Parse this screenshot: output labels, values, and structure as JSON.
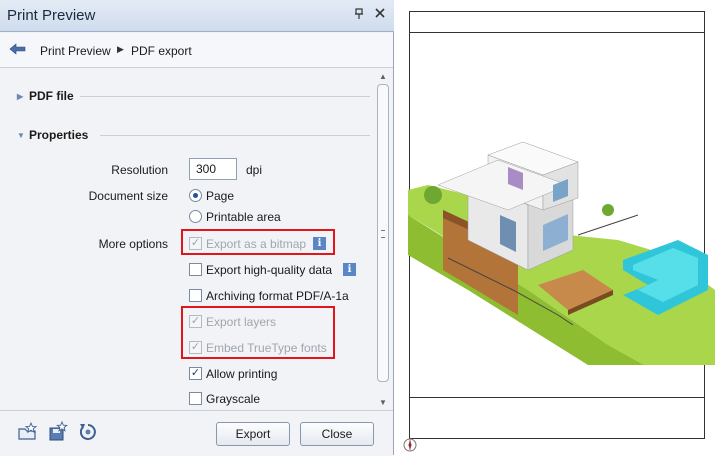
{
  "window": {
    "title": "Print Preview",
    "pin_glyph": "📌",
    "close_glyph": "✕"
  },
  "breadcrumb": {
    "items": [
      "Print Preview",
      "PDF export"
    ],
    "separator": "▶"
  },
  "sections": {
    "pdf_file": {
      "label": "PDF file",
      "expanded": false
    },
    "properties": {
      "label": "Properties",
      "expanded": true
    }
  },
  "resolution": {
    "label": "Resolution",
    "value": "300",
    "unit": "dpi"
  },
  "document_size": {
    "label": "Document size",
    "options": [
      {
        "label": "Page",
        "selected": true
      },
      {
        "label": "Printable area",
        "selected": false
      }
    ]
  },
  "more_options": {
    "label": "More options",
    "items": [
      {
        "label": "Export as a bitmap",
        "checked": true,
        "disabled": true,
        "info": true
      },
      {
        "label": "Export high-quality data",
        "checked": false,
        "disabled": false,
        "info": true
      },
      {
        "label": "Archiving format PDF/A-1a",
        "checked": false,
        "disabled": false,
        "info": false
      },
      {
        "label": "Export layers",
        "checked": true,
        "disabled": true,
        "info": false
      },
      {
        "label": "Embed TrueType fonts",
        "checked": true,
        "disabled": true,
        "info": false
      },
      {
        "label": "Allow printing",
        "checked": true,
        "disabled": false,
        "info": false
      },
      {
        "label": "Grayscale",
        "checked": false,
        "disabled": false,
        "info": false
      }
    ]
  },
  "buttons": {
    "export": "Export",
    "close": "Close"
  },
  "icons": {
    "back": "back-arrow-icon",
    "open_favorite": "open-favorite-icon",
    "save_favorite": "save-favorite-icon",
    "reset": "reset-icon",
    "info": "i"
  },
  "colors": {
    "highlight_box": "#e0161c",
    "accent": "#1f4fa8",
    "titlebar": "#d6e1ef"
  }
}
